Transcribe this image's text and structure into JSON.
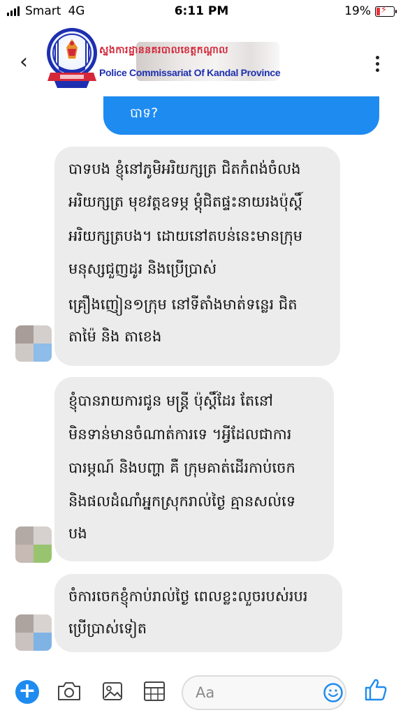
{
  "status": {
    "carrier": "Smart",
    "network": "4G",
    "time": "6:11 PM",
    "battery": "19%",
    "battery_level": 0.19
  },
  "header": {
    "logo_khmer": "ស្នងការដ្ឋាននគរបាលខេត្តកណ្ដាល",
    "logo_english": "Police Commissariat Of Kandal Province"
  },
  "sent": {
    "text": "បាទ?"
  },
  "messages": [
    {
      "lines": [
        "បាទបង ខ្ញុំនៅភូមិអរិយក្សត្រ ជិតកំពង់ចំលង",
        "អរិយក្សត្រ មុខវត្តឧទម្ភ ម្តុំជិតផ្ទះនាយរងប៉ុស្តិ៍",
        "អរិយក្សត្របង។ ដោយនៅតបន់នេះមានក្រុម",
        "មនុស្សជួញដូរ និងប្រើប្រាស់",
        "គ្រឿងញៀន១ក្រុម នៅទីតាំងមាត់ទន្លេរ ជិត",
        "តាម៉ៃ និង តាខេង"
      ]
    },
    {
      "lines": [
        "ខ្ញុំបានរាយការជូន មន្ត្រី ប៉ុស្ដិ៍ដែរ តែនៅ",
        "មិនទាន់មានចំណាត់ការទេ ។អ្វីដែលជាការ",
        "បារម្ភណ៍ និងបញ្ហា គឺ ក្រុមគាត់ដើរកាប់ចេក",
        "និងផលដំណាំអ្នកស្រុករាល់ថ្ងៃ គ្មានសល់ទេ",
        "បង"
      ]
    },
    {
      "lines": [
        "ចំការចេកខ្ញុំកាប់រាល់ថ្ងៃ ពេលខ្លះលួចរបស់របរ",
        "ប្រើប្រាស់ទៀត"
      ]
    }
  ],
  "composer": {
    "placeholder": "Aa"
  },
  "colors": {
    "accent": "#1e8bf0",
    "bubble": "#ececec"
  }
}
